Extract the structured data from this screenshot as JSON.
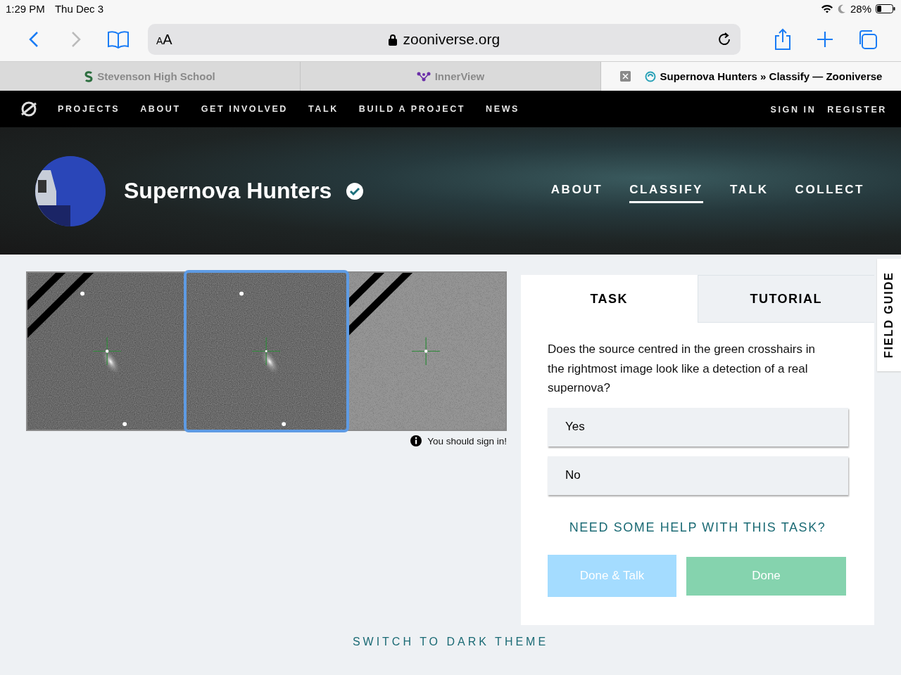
{
  "status_bar": {
    "time": "1:29 PM",
    "date": "Thu Dec 3",
    "battery": "28%"
  },
  "browser": {
    "text_size_button": "AA",
    "address": "zooniverse.org",
    "tabs": [
      {
        "label": "Stevenson High School",
        "selected": false
      },
      {
        "label": "InnerView",
        "selected": false
      },
      {
        "label": "Supernova Hunters » Classify — Zooniverse",
        "selected": true
      }
    ]
  },
  "site_nav": {
    "items": [
      "PROJECTS",
      "ABOUT",
      "GET INVOLVED",
      "TALK",
      "BUILD A PROJECT",
      "NEWS"
    ],
    "account": [
      "SIGN IN",
      "REGISTER"
    ]
  },
  "project": {
    "name": "Supernova Hunters",
    "verified": true,
    "nav": [
      {
        "label": "ABOUT",
        "selected": false
      },
      {
        "label": "CLASSIFY",
        "selected": true
      },
      {
        "label": "TALK",
        "selected": false
      },
      {
        "label": "COLLECT",
        "selected": false
      }
    ]
  },
  "subject": {
    "frames": [
      {
        "selected": false
      },
      {
        "selected": true
      },
      {
        "selected": false
      }
    ],
    "notice": "You should sign in!"
  },
  "task_panel": {
    "tabs": [
      {
        "label": "TASK",
        "selected": true
      },
      {
        "label": "TUTORIAL",
        "selected": false
      }
    ],
    "question": "Does the source centred in the green crosshairs in the rightmost image look like a detection of a real supernova?",
    "answers": [
      {
        "label": "Yes",
        "selected": false
      },
      {
        "label": "No",
        "selected": false
      }
    ],
    "help_link": "NEED SOME HELP WITH THIS TASK?",
    "buttons": [
      {
        "label": "Done & Talk",
        "kind": "talk"
      },
      {
        "label": "Done",
        "kind": "done"
      }
    ],
    "field_guide": "FIELD GUIDE"
  },
  "footer": {
    "theme_link": "SWITCH TO DARK THEME"
  }
}
